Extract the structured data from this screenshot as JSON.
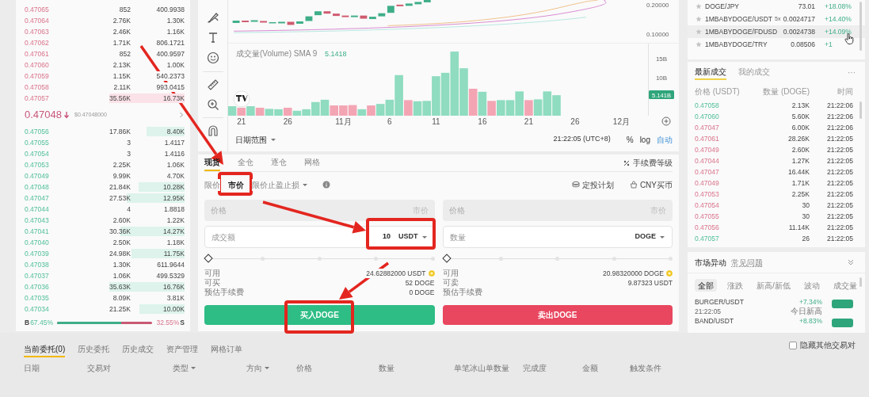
{
  "order_book": {
    "asks": [
      {
        "price": "0.47065",
        "amount": "852",
        "total": "400.9938"
      },
      {
        "price": "0.47064",
        "amount": "2.76K",
        "total": "1.30K"
      },
      {
        "price": "0.47063",
        "amount": "2.46K",
        "total": "1.16K"
      },
      {
        "price": "0.47062",
        "amount": "1.71K",
        "total": "806.1721"
      },
      {
        "price": "0.47061",
        "amount": "852",
        "total": "400.9597"
      },
      {
        "price": "0.47060",
        "amount": "2.13K",
        "total": "1.00K"
      },
      {
        "price": "0.47059",
        "amount": "1.15K",
        "total": "540.2373"
      },
      {
        "price": "0.47058",
        "amount": "2.11K",
        "total": "993.0415"
      },
      {
        "price": "0.47057",
        "amount": "35.56K",
        "total": "16.73K"
      }
    ],
    "last_price": {
      "price": "0.47048",
      "falling": true,
      "usd": "$0.47048000"
    },
    "bids": [
      {
        "price": "0.47056",
        "amount": "17.86K",
        "total": "8.40K"
      },
      {
        "price": "0.47055",
        "amount": "3",
        "total": "1.4117"
      },
      {
        "price": "0.47054",
        "amount": "3",
        "total": "1.4116"
      },
      {
        "price": "0.47053",
        "amount": "2.25K",
        "total": "1.06K"
      },
      {
        "price": "0.47049",
        "amount": "9.99K",
        "total": "4.70K"
      },
      {
        "price": "0.47048",
        "amount": "21.84K",
        "total": "10.28K"
      },
      {
        "price": "0.47047",
        "amount": "27.53K",
        "total": "12.95K"
      },
      {
        "price": "0.47044",
        "amount": "4",
        "total": "1.8818"
      },
      {
        "price": "0.47043",
        "amount": "2.60K",
        "total": "1.22K"
      },
      {
        "price": "0.47041",
        "amount": "30.36K",
        "total": "14.27K"
      },
      {
        "price": "0.47040",
        "amount": "2.50K",
        "total": "1.18K"
      },
      {
        "price": "0.47039",
        "amount": "24.98K",
        "total": "11.75K"
      },
      {
        "price": "0.47038",
        "amount": "1.30K",
        "total": "611.9644"
      },
      {
        "price": "0.47037",
        "amount": "1.06K",
        "total": "499.5329"
      },
      {
        "price": "0.47036",
        "amount": "35.63K",
        "total": "16.76K"
      },
      {
        "price": "0.47035",
        "amount": "8.09K",
        "total": "3.81K"
      },
      {
        "price": "0.47034",
        "amount": "21.25K",
        "total": "10.00K"
      }
    ],
    "ratio": {
      "buy_label": "B",
      "buy": "67.45%",
      "level": 0.6745,
      "sell": "32.55%",
      "sell_label": "S"
    }
  },
  "chart": {
    "price_axis": [
      "0.20000",
      "0.10000"
    ],
    "volume_title": "成交量(Volume) SMA 9",
    "volume_value": "5.1418",
    "current_badge": "5.141B",
    "chart_data": {
      "type": "bar",
      "stacked": true,
      "categories": [
        null,
        "21",
        null,
        null,
        null,
        null,
        "26",
        null,
        null,
        null,
        null,
        null,
        "11月",
        null,
        null,
        null,
        null,
        "6",
        null,
        null,
        null,
        null,
        "11",
        null,
        null,
        null,
        null,
        "16",
        null,
        null,
        null,
        null,
        "21",
        null,
        null,
        null,
        null,
        "26",
        null,
        null,
        null,
        null,
        "12月"
      ],
      "series": [
        {
          "color": "#8fdcc0",
          "values": [
            2.5,
            null,
            2.5,
            null,
            1.8,
            1.7,
            null,
            1.3,
            1.7,
            3.6,
            4.2,
            null,
            null,
            null,
            1.7,
            null,
            3.1,
            4.2,
            10.7,
            null,
            3.8,
            3.9,
            10.4,
            11.3,
            16.9,
            12.5,
            null,
            6.3,
            null,
            4.1,
            4.1,
            6.4,
            null,
            4.3,
            6.4,
            5.4,
            null,
            null,
            null,
            null,
            null,
            null,
            null
          ]
        },
        {
          "color": "#f3a5b4",
          "values": [
            null,
            2.1,
            null,
            2.1,
            null,
            null,
            2.1,
            null,
            null,
            null,
            null,
            2.7,
            2.7,
            2.8,
            null,
            2.7,
            null,
            null,
            null,
            4.1,
            null,
            null,
            null,
            null,
            null,
            null,
            7.1,
            null,
            3.9,
            null,
            null,
            null,
            4.1,
            null,
            null,
            null,
            null,
            null,
            null,
            null,
            null,
            null,
            null
          ]
        }
      ],
      "ylim": [
        0,
        19
      ],
      "yticks": [
        {
          "value": 10,
          "label": "10B"
        },
        {
          "value": 15,
          "label": "15B"
        }
      ]
    },
    "date_range": "日期范围",
    "time": "21:22:05 (UTC+8)",
    "scale_buttons": [
      {
        "label": "%",
        "selected": false
      },
      {
        "label": "log",
        "selected": false
      },
      {
        "label": "自动",
        "selected": true
      }
    ]
  },
  "trade": {
    "tabs": [
      {
        "label": "现货",
        "selected": true
      },
      {
        "label": "全仓",
        "selected": false
      },
      {
        "label": "逐仓",
        "selected": false
      },
      {
        "label": "网格",
        "selected": false
      }
    ],
    "fee_level": "手续费等级",
    "order_types": [
      {
        "label": "限价",
        "selected": false,
        "dropdown": false
      },
      {
        "label": "市价",
        "selected": true,
        "dropdown": false
      },
      {
        "label": "限价止盈止损",
        "selected": false,
        "dropdown": true
      }
    ],
    "links": [
      "定投计划",
      "CNY买币"
    ],
    "panels": [
      {
        "kind": "buy",
        "price_label": "价格",
        "price_value": "市价",
        "price_disabled": true,
        "amount_label": "成交额",
        "amount_value": "10",
        "unit": "USDT",
        "level": 0,
        "info": [
          {
            "label": "可用",
            "value": "24.62882000 USDT",
            "coin": true
          },
          {
            "label": "可买",
            "value": "52 DOGE"
          },
          {
            "label": "预估手续费",
            "value": "0 DOGE"
          }
        ],
        "button": "买入DOGE"
      },
      {
        "kind": "sell",
        "price_label": "价格",
        "price_value": "市价",
        "price_disabled": true,
        "amount_label": "数量",
        "unit": "DOGE",
        "level": 0,
        "info": [
          {
            "label": "可用",
            "value": "20.98320000 DOGE",
            "coin": true
          },
          {
            "label": "可卖",
            "value": "9.87323 USDT"
          },
          {
            "label": "预估手续费"
          }
        ],
        "button": "卖出DOGE"
      }
    ]
  },
  "market_list": [
    {
      "symbol": "DOGE/JPY",
      "price": "73.01",
      "change": "+18.08%",
      "hovered": false
    },
    {
      "symbol": "1MBABYDOGE/USDT",
      "leverage": "5x",
      "price": "0.0024717",
      "change": "+14.40%",
      "hovered": false
    },
    {
      "symbol": "1MBABYDOGE/FDUSD",
      "price": "0.0024738",
      "change": "+14.09%",
      "hovered": true
    },
    {
      "symbol": "1MBABYDOGE/TRY",
      "price": "0.08506",
      "change": "+1",
      "hovered": false
    }
  ],
  "latest_trades": {
    "tabs": [
      {
        "label": "最新成交",
        "selected": true
      },
      {
        "label": "我的成交",
        "selected": false
      }
    ],
    "more": "···",
    "columns": [
      "价格 (USDT)",
      "数量 (DOGE)",
      "时间"
    ],
    "rows": [
      {
        "price": "0.47058",
        "buy": true,
        "amount": "2.13K",
        "time": "21:22:06"
      },
      {
        "price": "0.47060",
        "buy": true,
        "amount": "5.60K",
        "time": "21:22:06"
      },
      {
        "price": "0.47047",
        "buy": false,
        "amount": "6.00K",
        "time": "21:22:06"
      },
      {
        "price": "0.47061",
        "buy": false,
        "amount": "28.26K",
        "time": "21:22:05"
      },
      {
        "price": "0.47049",
        "buy": false,
        "amount": "2.60K",
        "time": "21:22:05"
      },
      {
        "price": "0.47044",
        "buy": false,
        "amount": "1.27K",
        "time": "21:22:05"
      },
      {
        "price": "0.47047",
        "buy": false,
        "amount": "16.44K",
        "time": "21:22:05"
      },
      {
        "price": "0.47049",
        "buy": false,
        "amount": "1.71K",
        "time": "21:22:05"
      },
      {
        "price": "0.47053",
        "buy": false,
        "amount": "2.25K",
        "time": "21:22:05"
      },
      {
        "price": "0.47054",
        "buy": false,
        "amount": "30",
        "time": "21:22:05"
      },
      {
        "price": "0.47055",
        "buy": false,
        "amount": "30",
        "time": "21:22:05"
      },
      {
        "price": "0.47056",
        "buy": false,
        "amount": "11.14K",
        "time": "21:22:05"
      },
      {
        "price": "0.47057",
        "buy": true,
        "amount": "26",
        "time": "21:22:05"
      }
    ]
  },
  "market_movers": {
    "title": "市场异动",
    "help_link": "常见问题",
    "tabs": [
      {
        "label": "全部",
        "selected": true
      },
      {
        "label": "涨跌",
        "selected": false
      },
      {
        "label": "新高/新低",
        "selected": false
      },
      {
        "label": "波动",
        "selected": false
      },
      {
        "label": "成交量",
        "selected": false
      }
    ],
    "items": [
      {
        "symbol": "BURGER/USDT",
        "time": "21:22:05",
        "change": "+7.34%",
        "note": "今日新高"
      },
      {
        "symbol": "BAND/USDT",
        "change": "+8.83%"
      }
    ]
  },
  "orders": {
    "tabs": [
      {
        "label": "当前委托(0)",
        "selected": true
      },
      {
        "label": "历史委托",
        "selected": false
      },
      {
        "label": "历史成交",
        "selected": false
      },
      {
        "label": "资产管理",
        "selected": false
      },
      {
        "label": "网格订单",
        "selected": false
      }
    ],
    "hide_other_pairs": {
      "label": "隐藏其他交易对",
      "checked": false
    },
    "columns": [
      {
        "label": "日期",
        "sortable": false
      },
      {
        "label": "交易对",
        "sortable": false
      },
      {
        "label": "类型",
        "sortable": true
      },
      {
        "label": "方向",
        "sortable": true
      },
      {
        "label": "价格",
        "sortable": false
      },
      {
        "label": "数量",
        "sortable": false
      },
      {
        "label": "单笔冰山单数量",
        "sortable": false
      },
      {
        "label": "完成度",
        "sortable": false
      },
      {
        "label": "金额",
        "sortable": false
      },
      {
        "label": "触发条件",
        "sortable": false
      }
    ]
  }
}
